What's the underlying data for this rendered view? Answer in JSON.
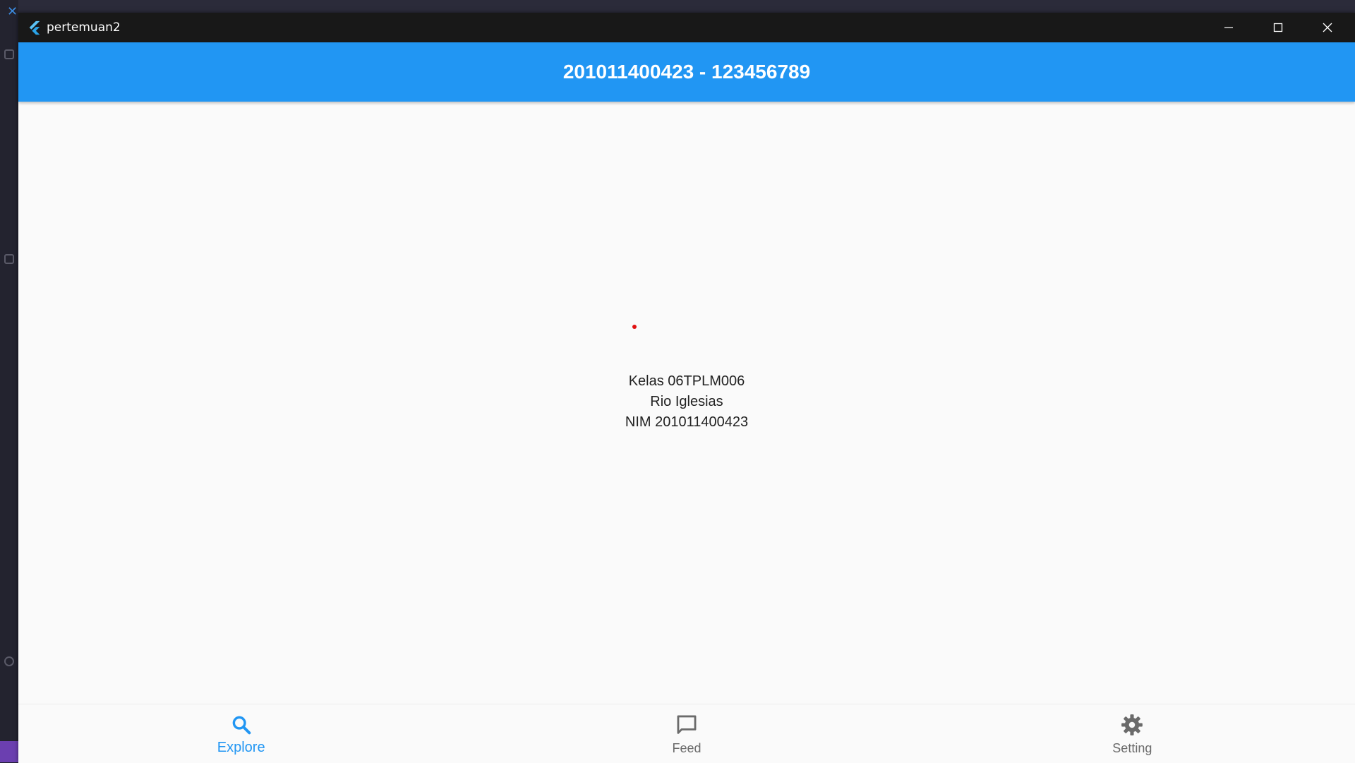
{
  "window": {
    "title": "pertemuan2"
  },
  "appbar": {
    "title": "201011400423 - 123456789",
    "color": "#2196f3"
  },
  "body": {
    "lines": [
      "Kelas 06TPLM006",
      "Rio Iglesias",
      "NIM 201011400423"
    ]
  },
  "bottom_nav": {
    "items": [
      {
        "label": "Explore",
        "icon": "search-icon",
        "active": true
      },
      {
        "label": "Feed",
        "icon": "chat-bubble-icon",
        "active": false
      },
      {
        "label": "Setting",
        "icon": "gear-icon",
        "active": false
      }
    ],
    "active_color": "#2196f3",
    "inactive_color": "#6b6b6b"
  }
}
